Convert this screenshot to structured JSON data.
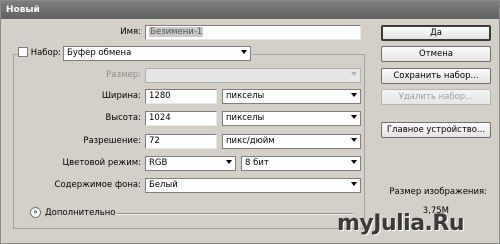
{
  "window": {
    "title": "Новый"
  },
  "form": {
    "name_label": "Имя:",
    "name_value": "Безимени-1",
    "preset_label": "Набор:",
    "preset_value": "Буфер обмена",
    "size_label": "Размер:",
    "size_value": "",
    "width_label": "Ширина:",
    "width_value": "1280",
    "width_unit": "пикселы",
    "height_label": "Высота:",
    "height_value": "1024",
    "height_unit": "пикселы",
    "resolution_label": "Разрешение:",
    "resolution_value": "72",
    "resolution_unit": "пикс/дюйм",
    "color_mode_label": "Цветовой режим:",
    "color_mode_value": "RGB",
    "bit_depth_value": "8 бит",
    "background_label": "Содержимое фона:",
    "background_value": "Белый",
    "advanced_label": "Дополнительно"
  },
  "buttons": {
    "ok": "Да",
    "cancel": "Отмена",
    "save_preset": "Сохранить набор...",
    "delete_preset": "Удалить набор...",
    "device_central": "Главное устройство..."
  },
  "info": {
    "image_size_label": "Размер изображения:",
    "image_size_value": "3,75M"
  },
  "watermark": {
    "text": "myJulia.Ru"
  },
  "colors": {
    "titlebar": "#6f6f6f",
    "dialog_bg": "#d4d0c8",
    "selection": "#c9c9c9"
  }
}
